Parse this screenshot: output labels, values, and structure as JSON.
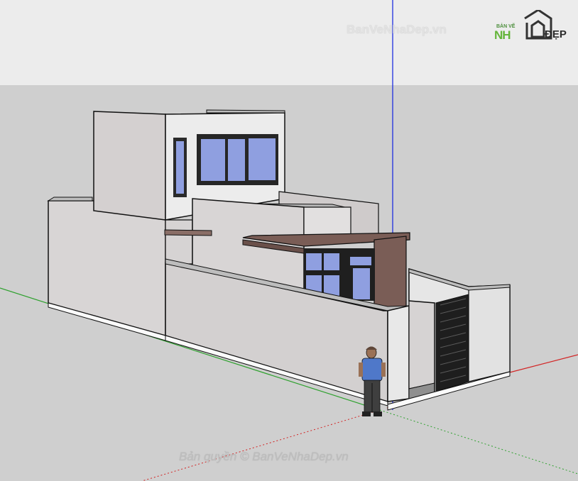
{
  "watermark_top": "BanVeNhaDep.vn",
  "logo": {
    "small_text": "BẢN VẼ",
    "nh_text": "NH",
    "dep_text": "ĐẸP"
  },
  "watermark_bottom": "Bản quyền © BanVeNhaDep.vn",
  "colors": {
    "sky": "#ececec",
    "ground": "#cfcfcf",
    "wall_light": "#ededed",
    "wall_mid": "#dcdcdc",
    "wall_shade": "#c9c6c6",
    "window_glass": "#8f9fe0",
    "wood_canopy": "#7a5d56",
    "axis_blue": "#1f2fe0",
    "axis_green": "#2fa12f",
    "axis_red": "#d22525"
  }
}
